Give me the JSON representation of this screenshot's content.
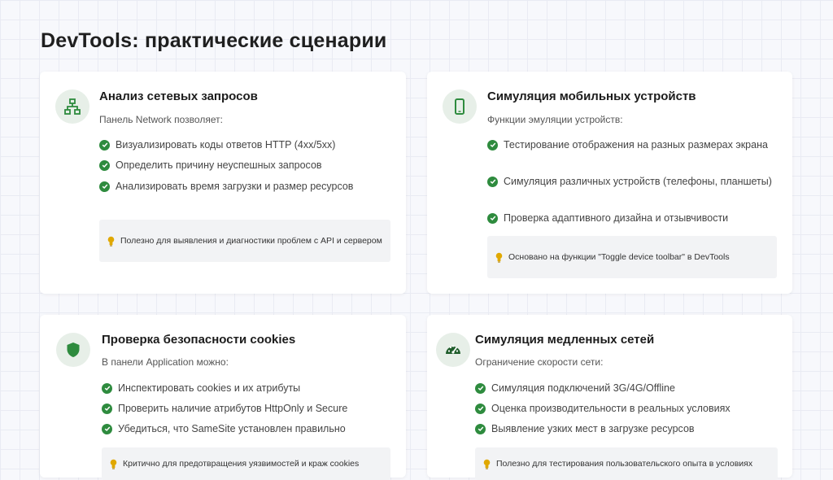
{
  "slide": {
    "title": "DevTools: практические сценарии"
  },
  "cards": [
    {
      "title": "Анализ сетевых запросов",
      "subtitle": "Панель Network позволяет:",
      "icon": "network-icon",
      "items": [
        "Визуализировать коды ответов HTTP (4xx/5xx)",
        "Определить причину неуспешных запросов",
        "Анализировать время загрузки и размер ресурсов"
      ],
      "note": "Полезно для выявления и диагностики проблем с API и сервером"
    },
    {
      "title": "Симуляция мобильных устройств",
      "subtitle": "Функции эмуляции устройств:",
      "icon": "mobile-icon",
      "items": [
        "Тестирование отображения на разных размерах экрана",
        "Симуляция различных устройств (телефоны, планшеты)",
        "Проверка адаптивного дизайна и отзывчивости"
      ],
      "note": "Основано на функции \"Toggle device toolbar\" в DevTools"
    },
    {
      "title": "Проверка безопасности cookies",
      "subtitle": "В панели Application можно:",
      "icon": "shield-icon",
      "items": [
        "Инспектировать cookies и их атрибуты",
        "Проверить наличие атрибутов HttpOnly и Secure",
        "Убедиться, что SameSite установлен правильно"
      ],
      "note": "Критично для предотвращения уязвимостей и краж cookies"
    },
    {
      "title": "Симуляция медленных сетей",
      "subtitle": "Ограничение скорости сети:",
      "icon": "speedometer-icon",
      "items": [
        "Симуляция подключений 3G/4G/Offline",
        "Оценка производительности в реальных условиях",
        "Выявление узких мест в загрузке ресурсов"
      ],
      "note": "Полезно для тестирования пользовательского опыта в условиях"
    }
  ],
  "colors": {
    "accent": "#2e8b3e",
    "icon_bg": "#e7efe8",
    "note_bg": "#f2f3f5",
    "bulb": "#e0a800"
  }
}
